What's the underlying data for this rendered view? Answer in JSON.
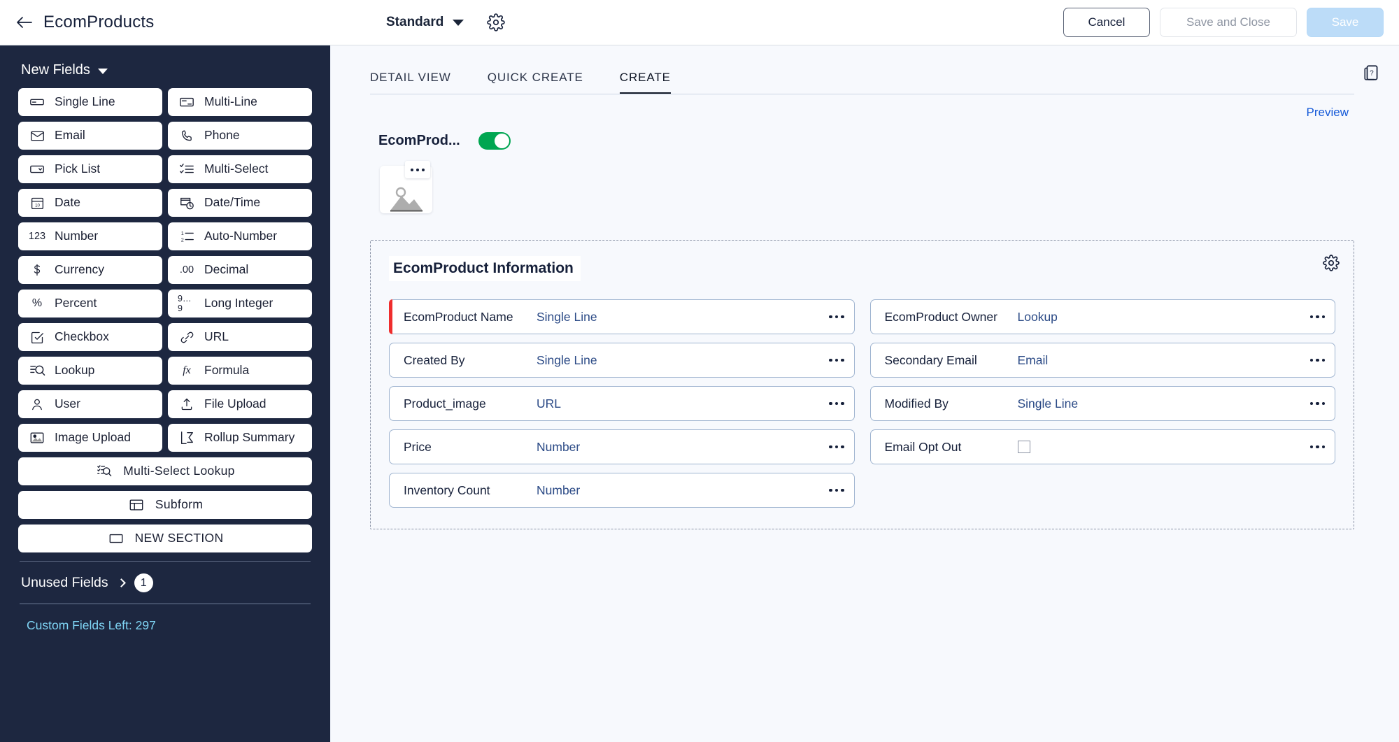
{
  "topbar": {
    "back_icon": "back-arrow-icon",
    "app_title": "EcomProducts",
    "layout_name": "Standard",
    "layout_caret_icon": "chevron-down-icon",
    "settings_icon": "gear-icon",
    "cancel_label": "Cancel",
    "save_and_close_label": "Save and Close",
    "save_label": "Save"
  },
  "sidebar": {
    "header_label": "New Fields",
    "header_caret_icon": "chevron-down-icon",
    "fields": [
      {
        "label": "Single Line",
        "icon": "single-line-icon"
      },
      {
        "label": "Multi-Line",
        "icon": "multi-line-icon"
      },
      {
        "label": "Email",
        "icon": "envelope-icon"
      },
      {
        "label": "Phone",
        "icon": "phone-icon"
      },
      {
        "label": "Pick List",
        "icon": "pick-list-icon"
      },
      {
        "label": "Multi-Select",
        "icon": "multi-select-icon"
      },
      {
        "label": "Date",
        "icon": "calendar-icon"
      },
      {
        "label": "Date/Time",
        "icon": "calendar-clock-icon"
      },
      {
        "label": "Number",
        "icon": "123-icon"
      },
      {
        "label": "Auto-Number",
        "icon": "auto-number-icon"
      },
      {
        "label": "Currency",
        "icon": "dollar-icon"
      },
      {
        "label": "Decimal",
        "icon": "decimal-icon"
      },
      {
        "label": "Percent",
        "icon": "percent-icon"
      },
      {
        "label": "Long Integer",
        "icon": "long-integer-icon"
      },
      {
        "label": "Checkbox",
        "icon": "checkbox-icon"
      },
      {
        "label": "URL",
        "icon": "link-icon"
      },
      {
        "label": "Lookup",
        "icon": "lookup-icon"
      },
      {
        "label": "Formula",
        "icon": "fx-icon"
      },
      {
        "label": "User",
        "icon": "user-icon"
      },
      {
        "label": "File Upload",
        "icon": "file-upload-icon"
      },
      {
        "label": "Image Upload",
        "icon": "image-upload-icon"
      },
      {
        "label": "Rollup Summary",
        "icon": "rollup-summary-icon"
      }
    ],
    "wide_fields": [
      {
        "label": "Multi-Select Lookup",
        "icon": "multi-select-lookup-icon"
      },
      {
        "label": "Subform",
        "icon": "subform-icon"
      },
      {
        "label": "NEW SECTION",
        "icon": "new-section-icon"
      }
    ],
    "unused_fields_label": "Unused Fields",
    "unused_fields_count": "1",
    "unused_chevron_icon": "chevron-right-icon",
    "custom_fields_left": "Custom Fields Left: 297"
  },
  "main": {
    "help_icon": "help-doc-icon",
    "tabs": [
      {
        "label": "CREATE",
        "active": true
      },
      {
        "label": "QUICK CREATE",
        "active": false
      },
      {
        "label": "DETAIL VIEW",
        "active": false
      }
    ],
    "preview_label": "Preview",
    "form_title": "EcomProd...",
    "form_toggle_state": "on",
    "image_placeholder_icon": "image-placeholder-icon",
    "image_menu_icon": "more-options-icon",
    "section": {
      "title": "EcomProduct Information",
      "settings_icon": "gear-icon",
      "left_fields": [
        {
          "label": "EcomProduct Name",
          "type": "Single Line",
          "required": true,
          "control": "text"
        },
        {
          "label": "Created By",
          "type": "Single Line",
          "required": false,
          "control": "text"
        },
        {
          "label": "Product_image",
          "type": "URL",
          "required": false,
          "control": "text"
        },
        {
          "label": "Price",
          "type": "Number",
          "required": false,
          "control": "text"
        },
        {
          "label": "Inventory Count",
          "type": "Number",
          "required": false,
          "control": "text"
        }
      ],
      "right_fields": [
        {
          "label": "EcomProduct Owner",
          "type": "Lookup",
          "required": false,
          "control": "text"
        },
        {
          "label": "Secondary Email",
          "type": "Email",
          "required": false,
          "control": "text"
        },
        {
          "label": "Modified By",
          "type": "Single Line",
          "required": false,
          "control": "text"
        },
        {
          "label": "Email Opt Out",
          "type": "",
          "required": false,
          "control": "checkbox"
        }
      ]
    }
  },
  "colors": {
    "sidebar_bg": "#1d2740",
    "accent_blue": "#1459d8",
    "toggle_green": "#00a651",
    "required_red": "#ef2d2d",
    "custom_fields_text": "#7fd5f5",
    "main_bg": "#f7f9fd"
  }
}
